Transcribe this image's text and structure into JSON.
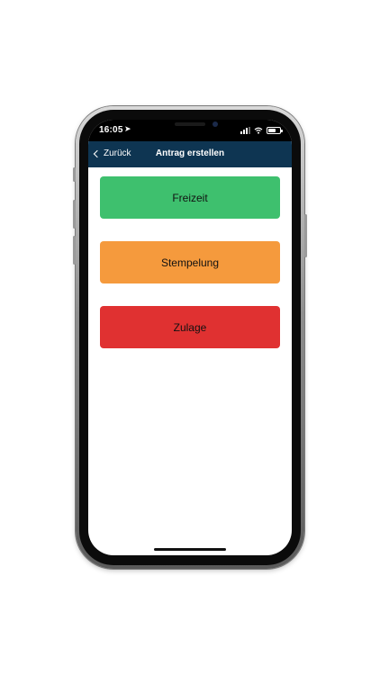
{
  "status_bar": {
    "time": "16:05",
    "location_icon": "location-arrow-icon",
    "signal_icon": "cellular-signal-icon",
    "wifi_icon": "wifi-icon",
    "battery_icon": "battery-icon",
    "battery_level": 0.7
  },
  "navbar": {
    "back_label": "Zurück",
    "title": "Antrag erstellen",
    "background": "#0e3552"
  },
  "actions": [
    {
      "label": "Freizeit",
      "color": "#3ec06e"
    },
    {
      "label": "Stempelung",
      "color": "#f59a3d"
    },
    {
      "label": "Zulage",
      "color": "#e03131"
    }
  ]
}
